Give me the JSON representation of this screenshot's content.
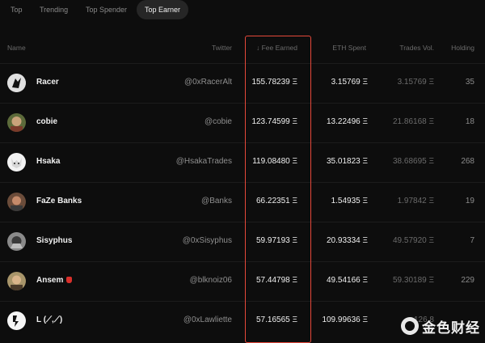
{
  "tabs": [
    {
      "label": "Top",
      "active": false
    },
    {
      "label": "Trending",
      "active": false
    },
    {
      "label": "Top Spender",
      "active": false
    },
    {
      "label": "Top Earner",
      "active": true
    }
  ],
  "columns": {
    "name": "Name",
    "twitter": "Twitter",
    "fee_earned": "Fee Earned",
    "eth_spent": "ETH Spent",
    "trades_vol": "Trades Vol.",
    "holding": "Holding"
  },
  "sort_icon": "arrow-down-icon",
  "rows": [
    {
      "name": "Racer",
      "twitter": "@0xRacerAlt",
      "fee_earned": "155.78239 Ξ",
      "eth_spent": "3.15769 Ξ",
      "trades_vol": "3.15769 Ξ",
      "holding": "35",
      "avatar": "#d8d8d8"
    },
    {
      "name": "cobie",
      "twitter": "@cobie",
      "fee_earned": "123.74599 Ξ",
      "eth_spent": "13.22496 Ξ",
      "trades_vol": "21.86168 Ξ",
      "holding": "18",
      "avatar": "#7a6a48"
    },
    {
      "name": "Hsaka",
      "twitter": "@HsakaTrades",
      "fee_earned": "119.08480 Ξ",
      "eth_spent": "35.01823 Ξ",
      "trades_vol": "38.68695 Ξ",
      "holding": "268",
      "avatar": "#e6e6e6"
    },
    {
      "name": "FaZe Banks",
      "twitter": "@Banks",
      "fee_earned": "66.22351 Ξ",
      "eth_spent": "1.54935 Ξ",
      "trades_vol": "1.97842 Ξ",
      "holding": "19",
      "avatar": "#8a6a50"
    },
    {
      "name": "Sisyphus",
      "twitter": "@0xSisyphus",
      "fee_earned": "59.97193 Ξ",
      "eth_spent": "20.93334 Ξ",
      "trades_vol": "49.57920 Ξ",
      "holding": "7",
      "avatar": "#6e6e6e"
    },
    {
      "name": "Ansem",
      "twitter": "@blknoiz06",
      "fee_earned": "57.44798 Ξ",
      "eth_spent": "49.54166 Ξ",
      "trades_vol": "59.30189 Ξ",
      "holding": "229",
      "avatar": "#9a8460"
    },
    {
      "name": "L (⟋,⟋)",
      "twitter": "@0xLawliette",
      "fee_earned": "57.16565 Ξ",
      "eth_spent": "109.99636 Ξ",
      "trades_vol": "126.8",
      "holding": "",
      "avatar": "#f0f0f0"
    }
  ],
  "watermark": {
    "text": "金色财经",
    "icon": "golden-finance-logo"
  },
  "colors": {
    "highlight": "#e5483a",
    "background": "#0d0d0d"
  }
}
